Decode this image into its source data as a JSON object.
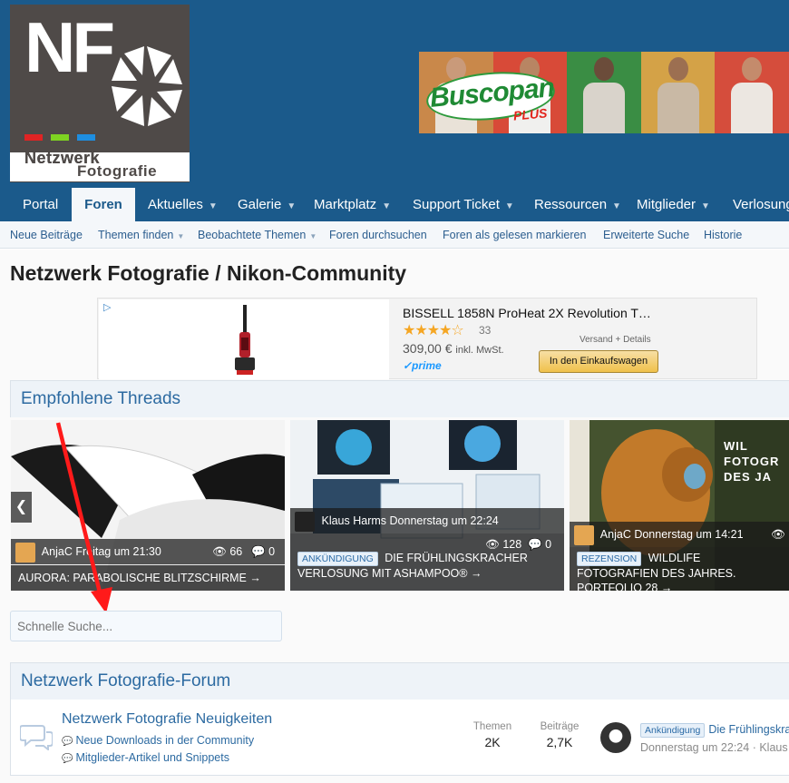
{
  "logo": {
    "letters": "NF",
    "word1": "Netzwerk",
    "word2": "Fotografie"
  },
  "banner": {
    "brand": "Buscopan",
    "plus": "PLUS"
  },
  "nav": {
    "items": [
      {
        "label": "Portal"
      },
      {
        "label": "Foren",
        "active": true
      },
      {
        "label": "Aktuelles",
        "caret": "▼"
      },
      {
        "label": "Galerie",
        "caret": "▼"
      },
      {
        "label": "Marktplatz",
        "caret": "▼"
      },
      {
        "label": "Support Ticket",
        "caret": "▼"
      },
      {
        "label": "Ressourcen",
        "caret": "▼"
      },
      {
        "label": "Mitglieder",
        "caret": "▼"
      },
      {
        "label": "Verlosung"
      }
    ]
  },
  "subnav": {
    "items": [
      {
        "label": "Neue Beiträge"
      },
      {
        "label": "Themen finden",
        "caret": "▼"
      },
      {
        "label": "Beobachtete Themen",
        "caret": "▼"
      },
      {
        "label": "Foren durchsuchen"
      },
      {
        "label": "Foren als gelesen markieren"
      },
      {
        "label": "Erweiterte Suche"
      },
      {
        "label": "Historie"
      }
    ]
  },
  "page_title": "Netzwerk Fotografie / Nikon-Community",
  "ad": {
    "info_icon": "▷",
    "title": "BISSELL 1858N ProHeat 2X Revolution T…",
    "stars": "★★★★☆",
    "reviews": "33",
    "price": "309,00 €",
    "price_note": "inkl. MwSt.",
    "prime": "✓prime",
    "shipping": "Versand + Details",
    "cart_button": "In den Einkaufswagen"
  },
  "featured": {
    "title": "Empfohlene Threads",
    "prev_arrow": "❮",
    "slides": [
      {
        "author": "AnjaC",
        "date": "Freitag um 21:30",
        "views": "66",
        "replies": "0",
        "title": "AURORA: PARABOLISCHE BLITZSCHIRME",
        "arrow": "→"
      },
      {
        "author": "Klaus Harms",
        "date": "Donnerstag um 22:24",
        "views": "128",
        "replies": "0",
        "prefix": "ANKÜNDIGUNG",
        "title": "DIE FRÜHLINGSKRACHER VERLOSUNG MIT ASHAMPOO®",
        "arrow": "→"
      },
      {
        "author": "AnjaC",
        "date": "Donnerstag um 14:21",
        "prefix": "REZENSION",
        "title": "WILDLIFE FOTOGRAFIEN DES JAHRES. PORTFOLIO 28",
        "arrow": "→",
        "image_text": "WIL FOTOGR DES JA"
      }
    ]
  },
  "search": {
    "placeholder": "Schnelle Suche..."
  },
  "forum_section": {
    "title": "Netzwerk Fotografie-Forum",
    "rows": [
      {
        "title": "Netzwerk Fotografie Neuigkeiten",
        "subforums": [
          "Neue Downloads in der Community",
          "Mitglieder-Artikel und Snippets"
        ],
        "threads_label": "Themen",
        "threads": "2K",
        "posts_label": "Beiträge",
        "posts": "2,7K",
        "latest_prefix": "Ankündigung",
        "latest_title": "Die Frühlingskra",
        "latest_meta": "Donnerstag um 22:24 · Klaus"
      }
    ]
  },
  "colors": {
    "header": "#1b5a8b",
    "link": "#2c6aa1",
    "arrow": "#ff1a1a"
  }
}
